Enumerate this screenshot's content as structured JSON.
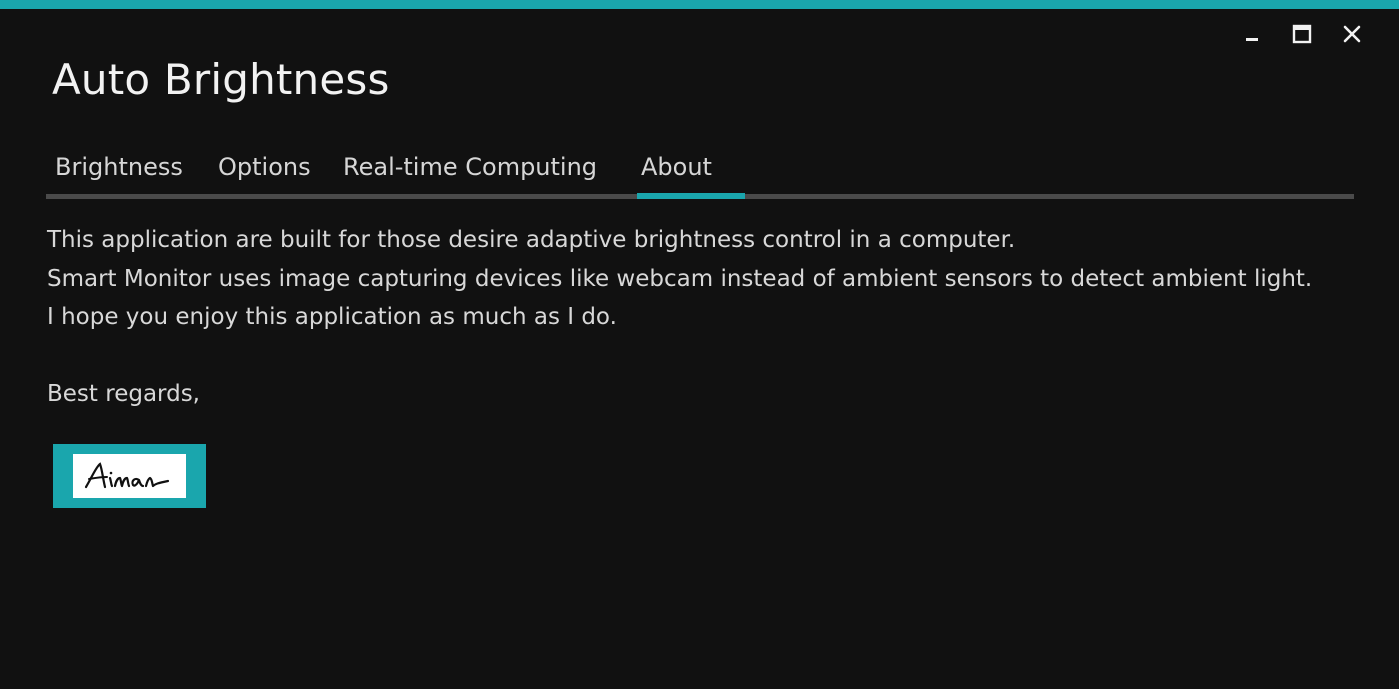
{
  "window": {
    "title": "Auto Brightness",
    "accent_color": "#1aa6ad",
    "background_color": "#111111",
    "controls": {
      "minimize_icon": "minimize-icon",
      "maximize_icon": "maximize-icon",
      "close_icon": "close-icon"
    }
  },
  "tabs": [
    {
      "label": "Brightness",
      "selected": false
    },
    {
      "label": "Options",
      "selected": false
    },
    {
      "label": "Real-time Computing",
      "selected": false
    },
    {
      "label": "About",
      "selected": true
    }
  ],
  "about": {
    "lines": [
      "This application are built for those desire adaptive brightness control in a computer.",
      "Smart Monitor uses image capturing devices like webcam instead of ambient sensors to detect ambient light.",
      "I hope you enjoy this application as much as I do."
    ],
    "closing": "Best regards,",
    "signature": "Aiman"
  }
}
